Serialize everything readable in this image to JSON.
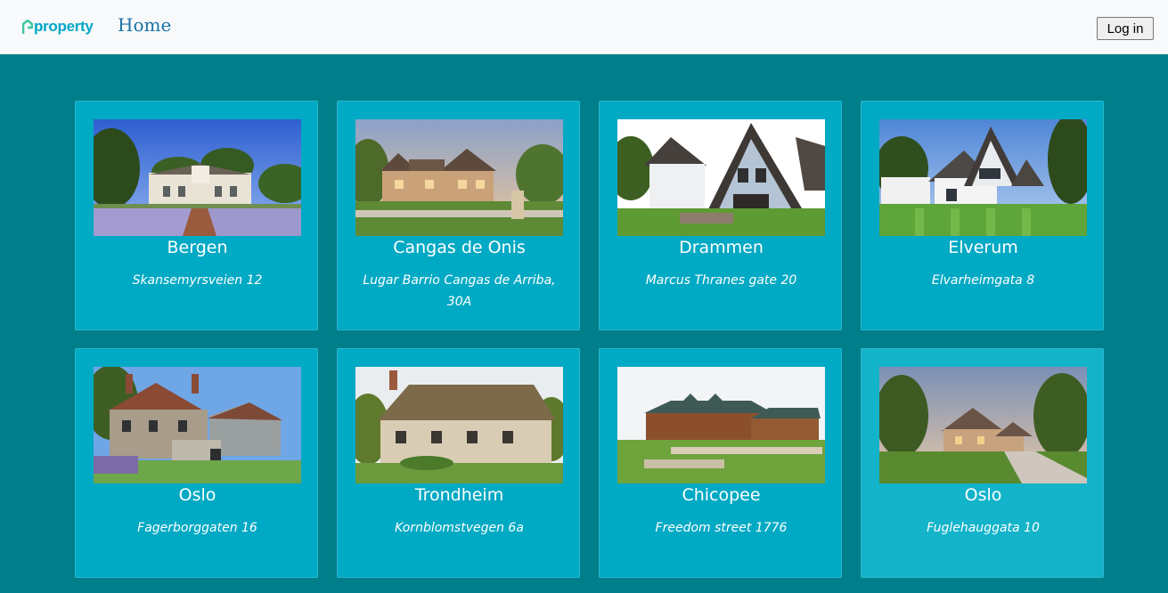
{
  "brand": {
    "name": "property",
    "color": "#00a7c6"
  },
  "nav": {
    "home_label": "Home",
    "login_label": "Log in"
  },
  "colors": {
    "page_bg": "#007f8a",
    "card_bg": "#00a9c4",
    "card_hover_bg": "#13b3c9"
  },
  "listings": [
    {
      "city": "Bergen",
      "address": "Skansemyrsveien 12",
      "image": "white-cape-dutch-house-with-lavender-field"
    },
    {
      "city": "Cangas de Onis",
      "address": "Lugar Barrio Cangas de Arriba, 30A",
      "image": "stone-brick-house-at-sunset"
    },
    {
      "city": "Drammen",
      "address": "Marcus Thranes gate 20",
      "image": "modern-white-gabled-houses"
    },
    {
      "city": "Elverum",
      "address": "Elvarheimgata 8",
      "image": "white-house-with-striped-lawn"
    },
    {
      "city": "Oslo",
      "address": "Fagerborggaten 16",
      "image": "flint-stone-cottage"
    },
    {
      "city": "Trondheim",
      "address": "Kornblomstvegen 6a",
      "image": "thatched-roof-cottage"
    },
    {
      "city": "Chicopee",
      "address": "Freedom street 1776",
      "image": "log-ranch-house"
    },
    {
      "city": "Oslo",
      "address": "Fuglehauggata 10",
      "image": "stone-house-with-long-driveway"
    }
  ]
}
